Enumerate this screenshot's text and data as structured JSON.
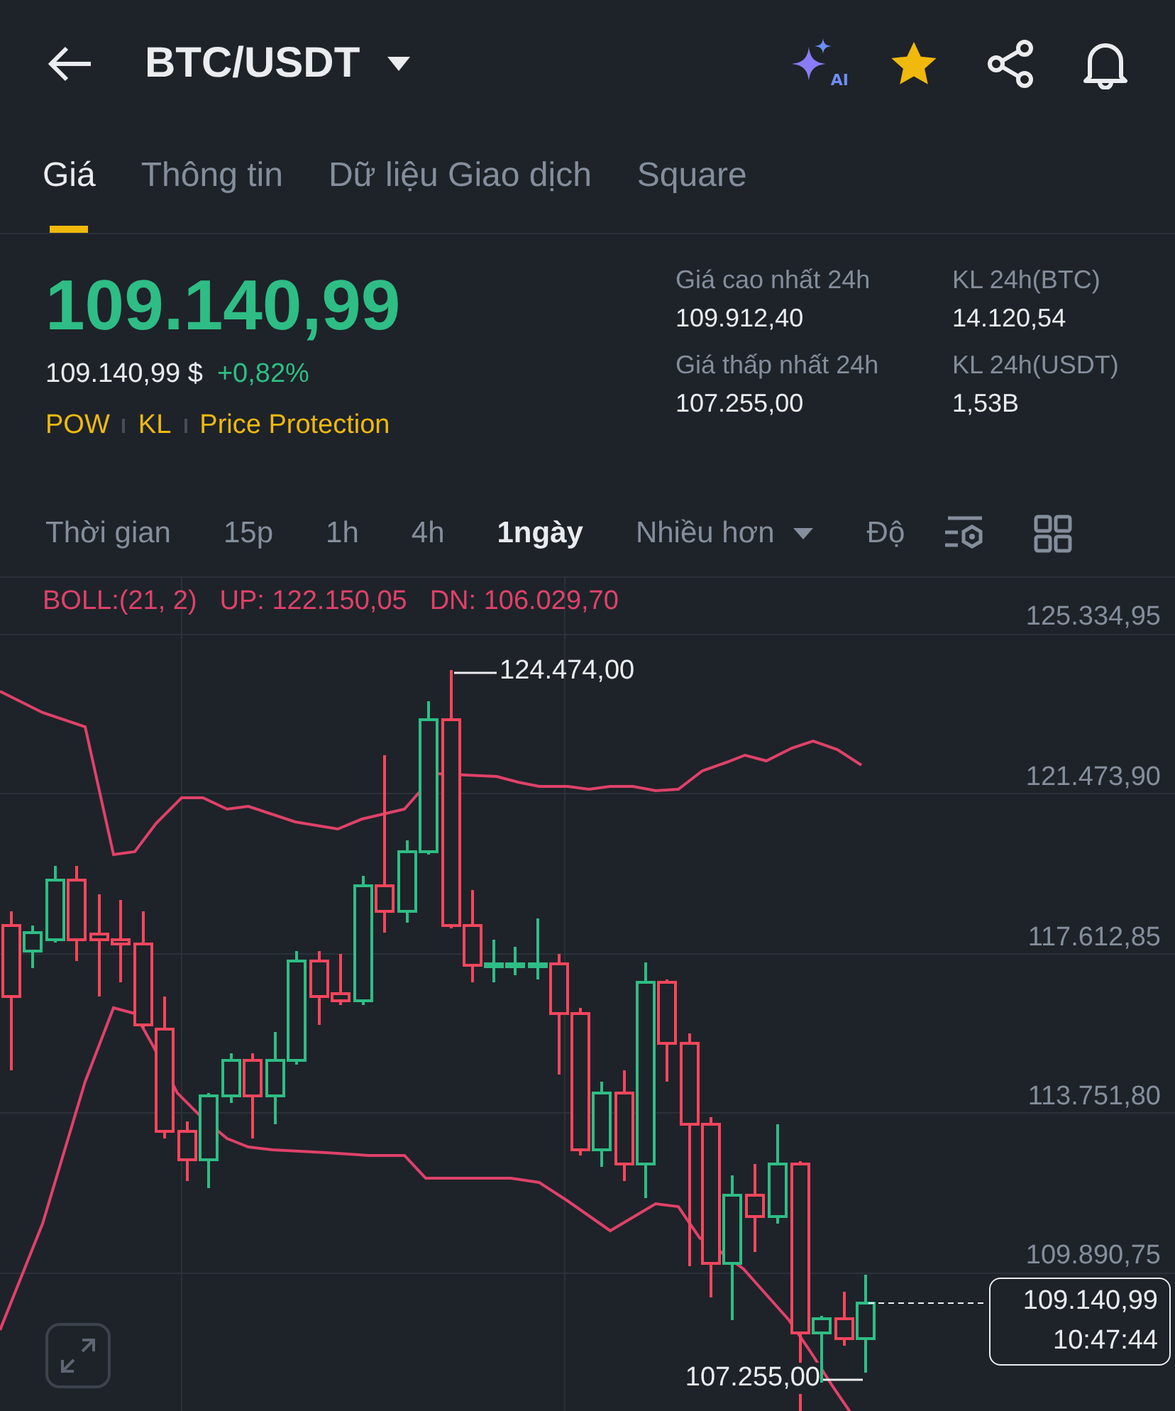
{
  "header": {
    "title": "BTC/USDT",
    "ai_badge": "AI"
  },
  "tabs": [
    {
      "label": "Giá",
      "selected": true
    },
    {
      "label": "Thông tin",
      "selected": false
    },
    {
      "label": "Dữ liệu Giao dịch",
      "selected": false
    },
    {
      "label": "Square",
      "selected": false
    }
  ],
  "price": {
    "last": "109.140,99",
    "usd": "109.140,99 $",
    "change": "+0,82%",
    "tags": [
      "POW",
      "KL",
      "Price Protection"
    ]
  },
  "stats": [
    {
      "label": "Giá cao nhất 24h",
      "value": "109.912,40"
    },
    {
      "label": "KL 24h(BTC)",
      "value": "14.120,54"
    },
    {
      "label": "Giá thấp nhất 24h",
      "value": "107.255,00"
    },
    {
      "label": "KL 24h(USDT)",
      "value": "1,53B"
    }
  ],
  "intervals": [
    {
      "label": "Thời gian",
      "selected": false
    },
    {
      "label": "15p",
      "selected": false
    },
    {
      "label": "1h",
      "selected": false
    },
    {
      "label": "4h",
      "selected": false
    },
    {
      "label": "1ngày",
      "selected": true
    }
  ],
  "more": "Nhiều hơn",
  "cut_item": "Độ",
  "indicator": [
    "BOLL:(21, 2)",
    "UP: 122.150,05",
    "DN: 106.029,70"
  ],
  "price_axis": [
    "125.334,95",
    "121.473,90",
    "117.612,85",
    "113.751,80",
    "109.890,75"
  ],
  "high_label": "124.474,00",
  "low_label": "107.255,00",
  "current": {
    "price": "109.140,99",
    "time": "10:47:44"
  }
}
